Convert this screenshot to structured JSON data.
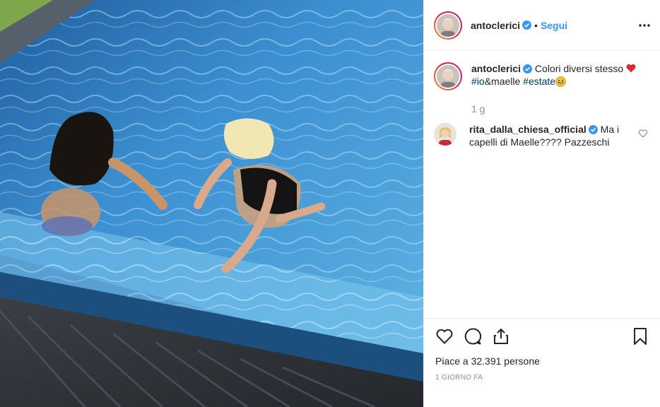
{
  "post": {
    "author": "antoclerici",
    "follow_label": "Segui",
    "dot": "•"
  },
  "caption": {
    "username": "antoclerici",
    "text": "Colori diversi stesso",
    "hashtag1": "#io",
    "mid": "&maelle ",
    "hashtag2": "#estate",
    "time": "1 g"
  },
  "comments": [
    {
      "username": "rita_dalla_chiesa_official",
      "text": "Ma i capelli di Maelle???? Pazzeschi"
    }
  ],
  "actions": {
    "likes_prefix": "Piace a ",
    "likes_count": "32.391",
    "likes_suffix": " persone",
    "posted_ago": "1 GIORNO FA"
  },
  "colors": {
    "accent": "#3897f0",
    "verified": "#3897f0",
    "heart": "#ed4956",
    "pool": "#2f7fc8"
  },
  "icons": [
    "verified-icon",
    "more-options-icon",
    "heart-icon",
    "comment-icon",
    "share-icon",
    "bookmark-icon",
    "small-heart-icon",
    "red-heart-emoji",
    "grinning-emoji"
  ]
}
